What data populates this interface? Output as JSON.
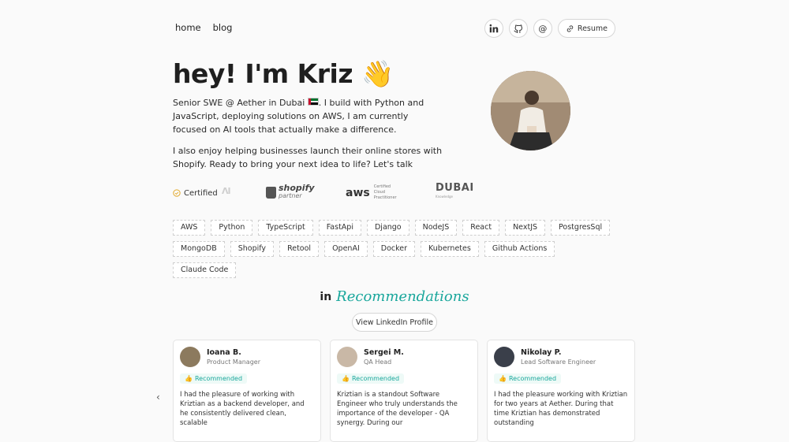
{
  "nav": {
    "home": "home",
    "blog": "blog"
  },
  "social": {
    "linkedin": "in",
    "github": "github-icon",
    "email": "@",
    "resume": "Resume"
  },
  "hero": {
    "title": "hey! I'm Kriz",
    "wave": "👋",
    "bio1_a": "Senior SWE @ Aether in Dubai",
    "bio1_b": ". I build with Python and JavaScript, deploying solutions on AWS, I am currently focused on AI tools that actually make a difference.",
    "bio2": "I also enjoy helping businesses launch their online stores with Shopify. Ready to bring your next idea to life? Let's talk"
  },
  "certs": {
    "label": "Certified",
    "cut_logo": "ɅI",
    "shopify": "shopify",
    "shopify_sub": "partner",
    "aws": "aws",
    "aws_sub1": "Certified Cloud",
    "aws_sub2": "Practitioner",
    "dubai": "DUBAI",
    "dubai_sub": "Knowledge"
  },
  "tags": [
    "AWS",
    "Python",
    "TypeScript",
    "FastApi",
    "Django",
    "NodeJS",
    "React",
    "NextJS",
    "PostgresSql",
    "MongoDB",
    "Shopify",
    "Retool",
    "OpenAI",
    "Docker",
    "Kubernetes",
    "Github Actions",
    "Claude Code"
  ],
  "recommendations": {
    "li": "in",
    "title": "Recommendations",
    "view_button": "View LinkedIn Profile",
    "badge": "Recommended",
    "cards": [
      {
        "name": "Ioana B.",
        "role": "Product Manager",
        "text": "I had the pleasure of working with Kriztian as a backend developer, and he consistently delivered clean, scalable",
        "color": "#8c7a5e"
      },
      {
        "name": "Sergei M.",
        "role": "QA Head",
        "text": "Kriztian is a standout Software Engineer who truly understands the importance of the developer - QA synergy. During our",
        "color": "#c9b8a6"
      },
      {
        "name": "Nikolay P.",
        "role": "Lead Software Engineer",
        "text": "I had the pleasure working with Kriztian for two years at Aether. During that time Kriztian has demonstrated outstanding",
        "color": "#3a3f4a"
      }
    ]
  },
  "colors": {
    "accent": "#1aa79c",
    "background": "#fafafa"
  }
}
